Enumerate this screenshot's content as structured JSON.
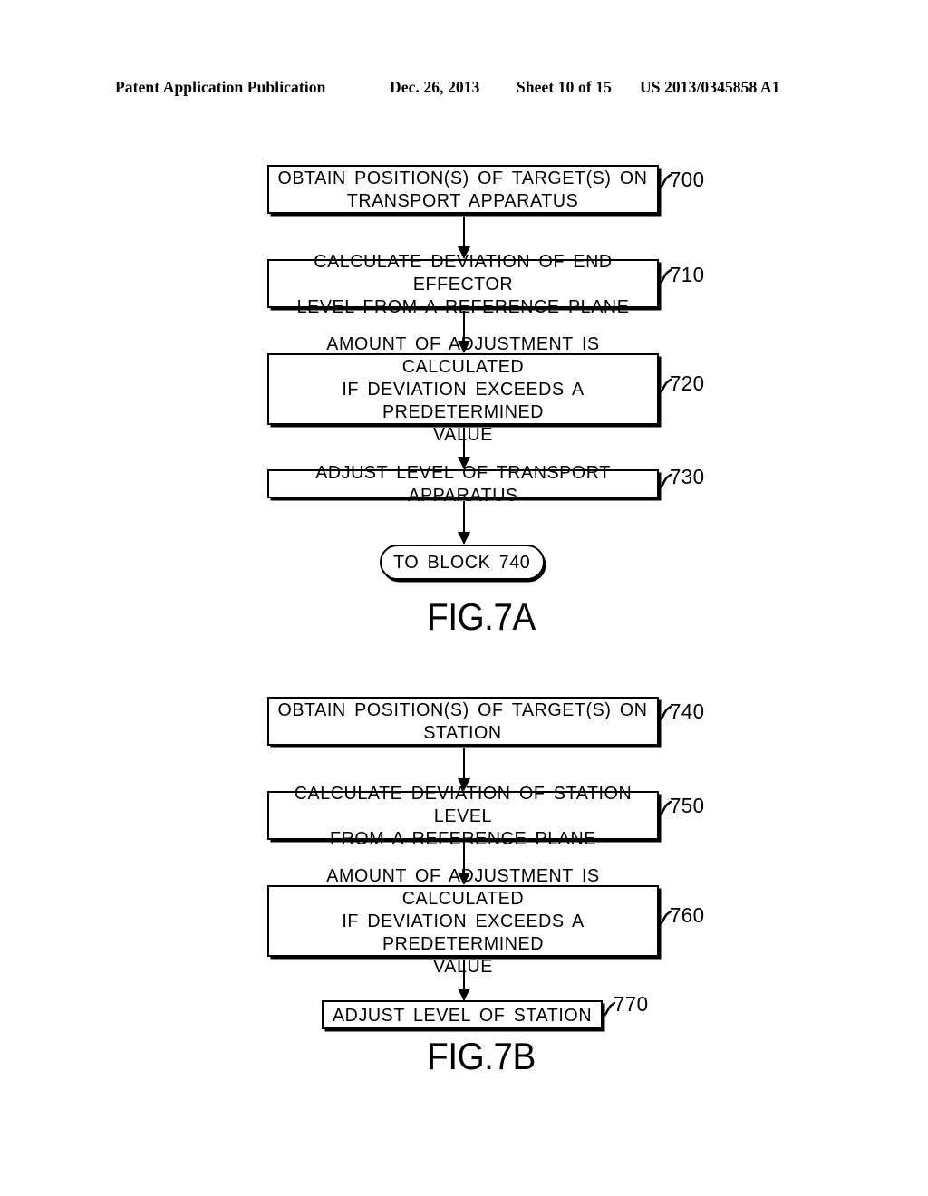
{
  "header": {
    "publication": "Patent Application Publication",
    "date": "Dec. 26, 2013",
    "sheet": "Sheet 10 of 15",
    "patent_number": "US 2013/0345858 A1"
  },
  "figures": [
    {
      "caption": "FIG.7A",
      "nodes": [
        {
          "ref": "700",
          "shape": "process",
          "text": "OBTAIN  POSITION(S)  OF  TARGET(S)  ON\nTRANSPORT  APPARATUS"
        },
        {
          "ref": "710",
          "shape": "process",
          "text": "CALCULATE  DEVIATION  OF  END  EFFECTOR\nLEVEL  FROM  A  REFERENCE  PLANE"
        },
        {
          "ref": "720",
          "shape": "process",
          "text": "AMOUNT  OF  ADJUSTMENT  IS  CALCULATED\nIF  DEVIATION  EXCEEDS  A  PREDETERMINED\nVALUE"
        },
        {
          "ref": "730",
          "shape": "process",
          "text": "ADJUST  LEVEL  OF  TRANSPORT  APPARATUS"
        },
        {
          "ref": "",
          "shape": "terminal",
          "text": "TO  BLOCK  740"
        }
      ]
    },
    {
      "caption": "FIG.7B",
      "nodes": [
        {
          "ref": "740",
          "shape": "process",
          "text": "OBTAIN  POSITION(S)  OF  TARGET(S)  ON\nSTATION"
        },
        {
          "ref": "750",
          "shape": "process",
          "text": "CALCULATE  DEVIATION  OF  STATION  LEVEL\nFROM  A  REFERENCE  PLANE"
        },
        {
          "ref": "760",
          "shape": "process",
          "text": "AMOUNT  OF  ADJUSTMENT  IS  CALCULATED\nIF  DEVIATION  EXCEEDS  A  PREDETERMINED\nVALUE"
        },
        {
          "ref": "770",
          "shape": "process",
          "text": "ADJUST  LEVEL  OF  STATION"
        }
      ]
    }
  ]
}
